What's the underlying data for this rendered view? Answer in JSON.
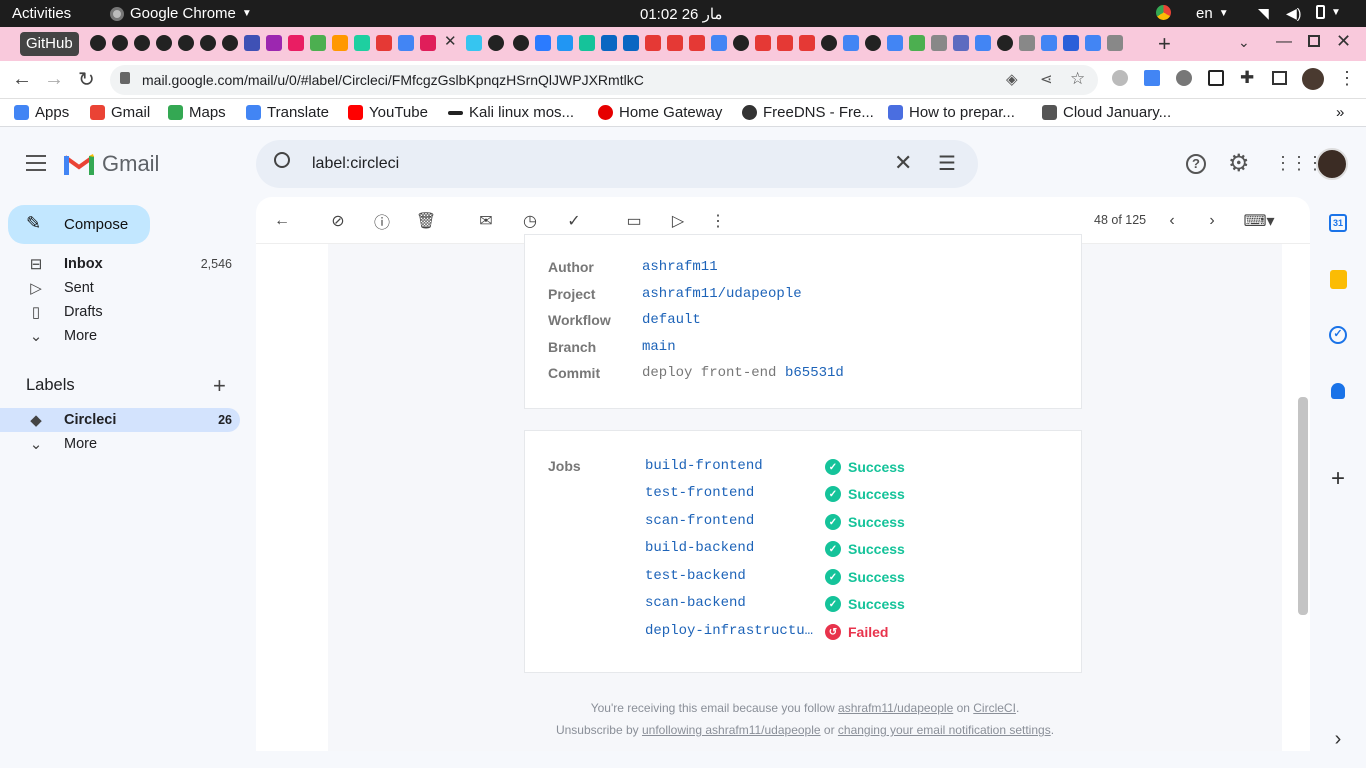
{
  "os_bar": {
    "activities": "Activities",
    "app": "Google Chrome",
    "clock": "01:02  مار 26",
    "lang": "en"
  },
  "tabs": {
    "active_label": "GitHub"
  },
  "address": {
    "url": "mail.google.com/mail/u/0/#label/Circleci/FMfcgzGslbKpnqzHSrnQlJWPJXRmtlkC"
  },
  "bookmarks": [
    {
      "label": "Apps",
      "color": "#4285f4"
    },
    {
      "label": "Gmail",
      "color": "#ea4335"
    },
    {
      "label": "Maps",
      "color": "#34a853"
    },
    {
      "label": "Translate",
      "color": "#4285f4"
    },
    {
      "label": "YouTube",
      "color": "#ff0000"
    },
    {
      "label": "Kali linux mos...",
      "color": "#222222"
    },
    {
      "label": "Home Gateway",
      "color": "#e60000"
    },
    {
      "label": "FreeDNS - Fre...",
      "color": "#333333"
    },
    {
      "label": "How to prepar...",
      "color": "#4a6ee0"
    },
    {
      "label": "Cloud January...",
      "color": "#555555"
    }
  ],
  "gmail": {
    "brand": "Gmail",
    "search_value": "label:circleci",
    "compose": "Compose",
    "nav": [
      {
        "label": "Inbox",
        "count": "2,546",
        "icon": "inbox-icon"
      },
      {
        "label": "Sent",
        "count": "",
        "icon": "send-icon"
      },
      {
        "label": "Drafts",
        "count": "",
        "icon": "draft-icon"
      },
      {
        "label": "More",
        "count": "",
        "icon": "chevron-down-icon"
      }
    ],
    "labels_title": "Labels",
    "labels": [
      {
        "label": "Circleci",
        "count": "26"
      }
    ],
    "labels_more": "More",
    "pagination": "48 of 125"
  },
  "email": {
    "details": [
      {
        "key": "Author",
        "value": "ashrafm11",
        "extra": ""
      },
      {
        "key": "Project",
        "value": "ashrafm11/udapeople",
        "extra": ""
      },
      {
        "key": "Workflow",
        "value": "default",
        "extra": ""
      },
      {
        "key": "Branch",
        "value": "main",
        "extra": ""
      },
      {
        "key": "Commit",
        "value": "b65531d",
        "extra": "deploy front-end"
      }
    ],
    "jobs_title": "Jobs",
    "jobs": [
      {
        "name": "build-frontend",
        "status": "Success"
      },
      {
        "name": "test-frontend",
        "status": "Success"
      },
      {
        "name": "scan-frontend",
        "status": "Success"
      },
      {
        "name": "build-backend",
        "status": "Success"
      },
      {
        "name": "test-backend",
        "status": "Success"
      },
      {
        "name": "scan-backend",
        "status": "Success"
      },
      {
        "name": "deploy-infrastructu…",
        "status": "Failed"
      }
    ],
    "footer": {
      "line1_pre": "You're receiving this email because you follow ",
      "line1_link": "ashrafm11/udapeople",
      "line1_mid": " on ",
      "line1_link2": "CircleCI",
      "line1_post": ".",
      "line2_pre": "Unsubscribe by ",
      "line2_link": "unfollowing ashrafm11/udapeople",
      "line2_mid": " or ",
      "line2_link2": "changing your email notification settings",
      "line2_post": "."
    }
  },
  "colors": {
    "success": "#15c39a",
    "failed": "#e8334c",
    "link": "#1d63b8",
    "compose_bg": "#c2e7ff"
  }
}
